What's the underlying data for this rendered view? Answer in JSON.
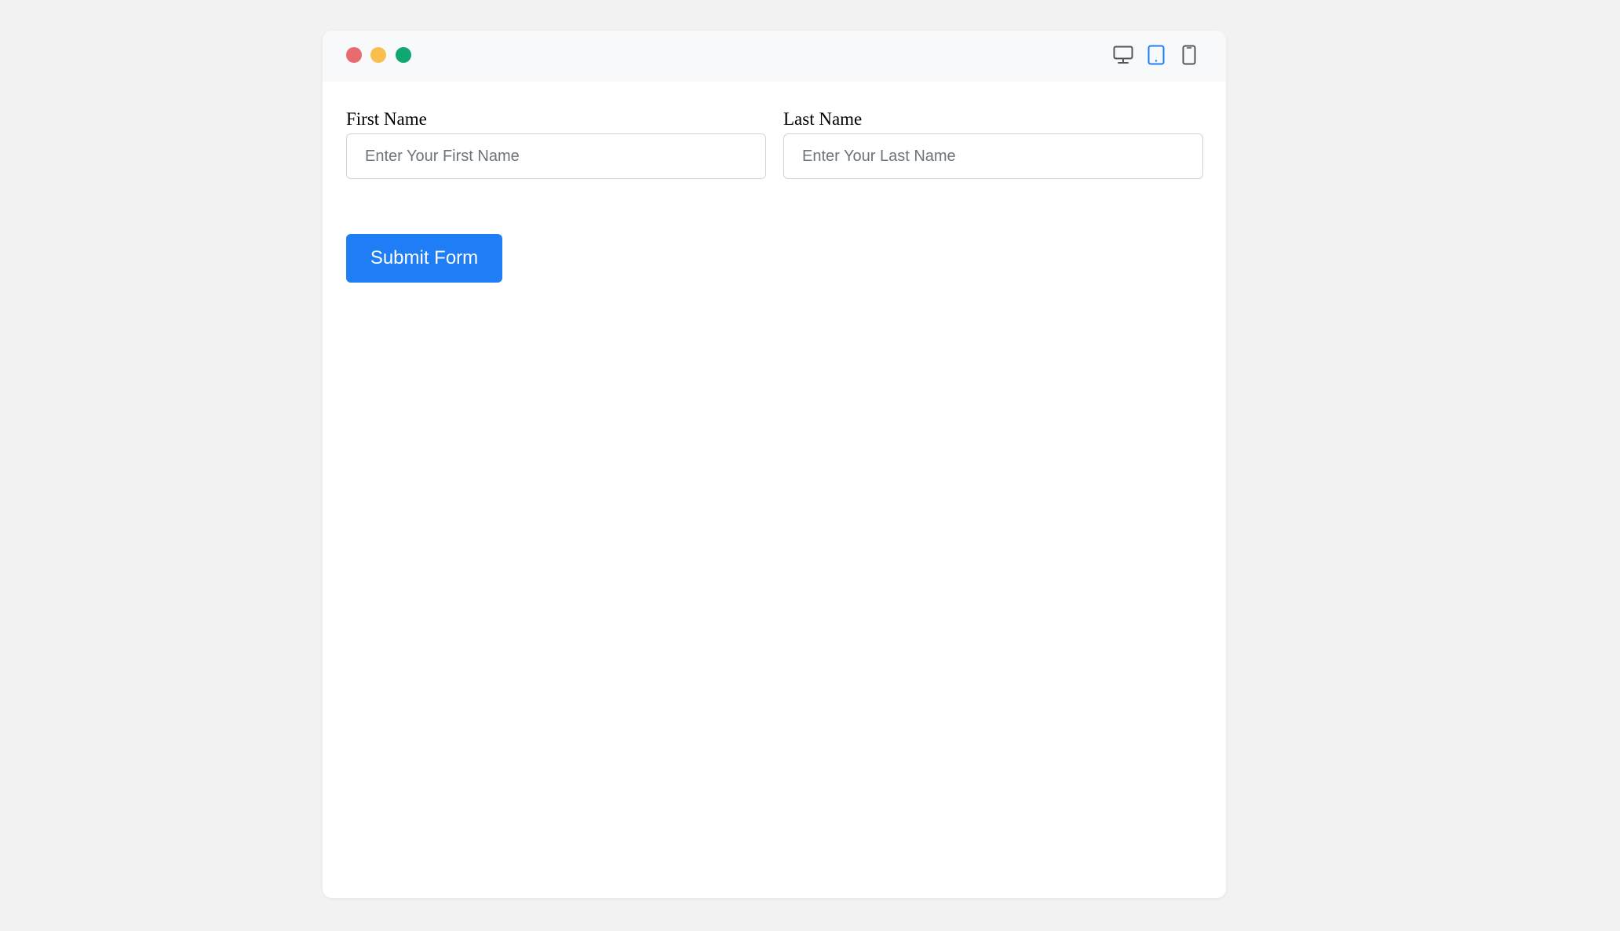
{
  "window": {
    "controls": [
      {
        "name": "close",
        "color": "#e86b70"
      },
      {
        "name": "minimize",
        "color": "#f8bf4f"
      },
      {
        "name": "maximize",
        "color": "#11a773"
      }
    ],
    "device_toggles": [
      {
        "name": "desktop",
        "icon": "monitor-icon",
        "active": false,
        "color": "#555555"
      },
      {
        "name": "tablet",
        "icon": "tablet-icon",
        "active": true,
        "color": "#1f7ef5"
      },
      {
        "name": "mobile",
        "icon": "phone-icon",
        "active": false,
        "color": "#555555"
      }
    ]
  },
  "form": {
    "first_name": {
      "label": "First Name",
      "placeholder": "Enter Your First Name",
      "value": ""
    },
    "last_name": {
      "label": "Last Name",
      "placeholder": "Enter Your Last Name",
      "value": ""
    },
    "submit_label": "Submit Form"
  },
  "colors": {
    "accent": "#1f7ef5",
    "background": "#f2f2f2",
    "titlebar": "#f8f9fa"
  }
}
